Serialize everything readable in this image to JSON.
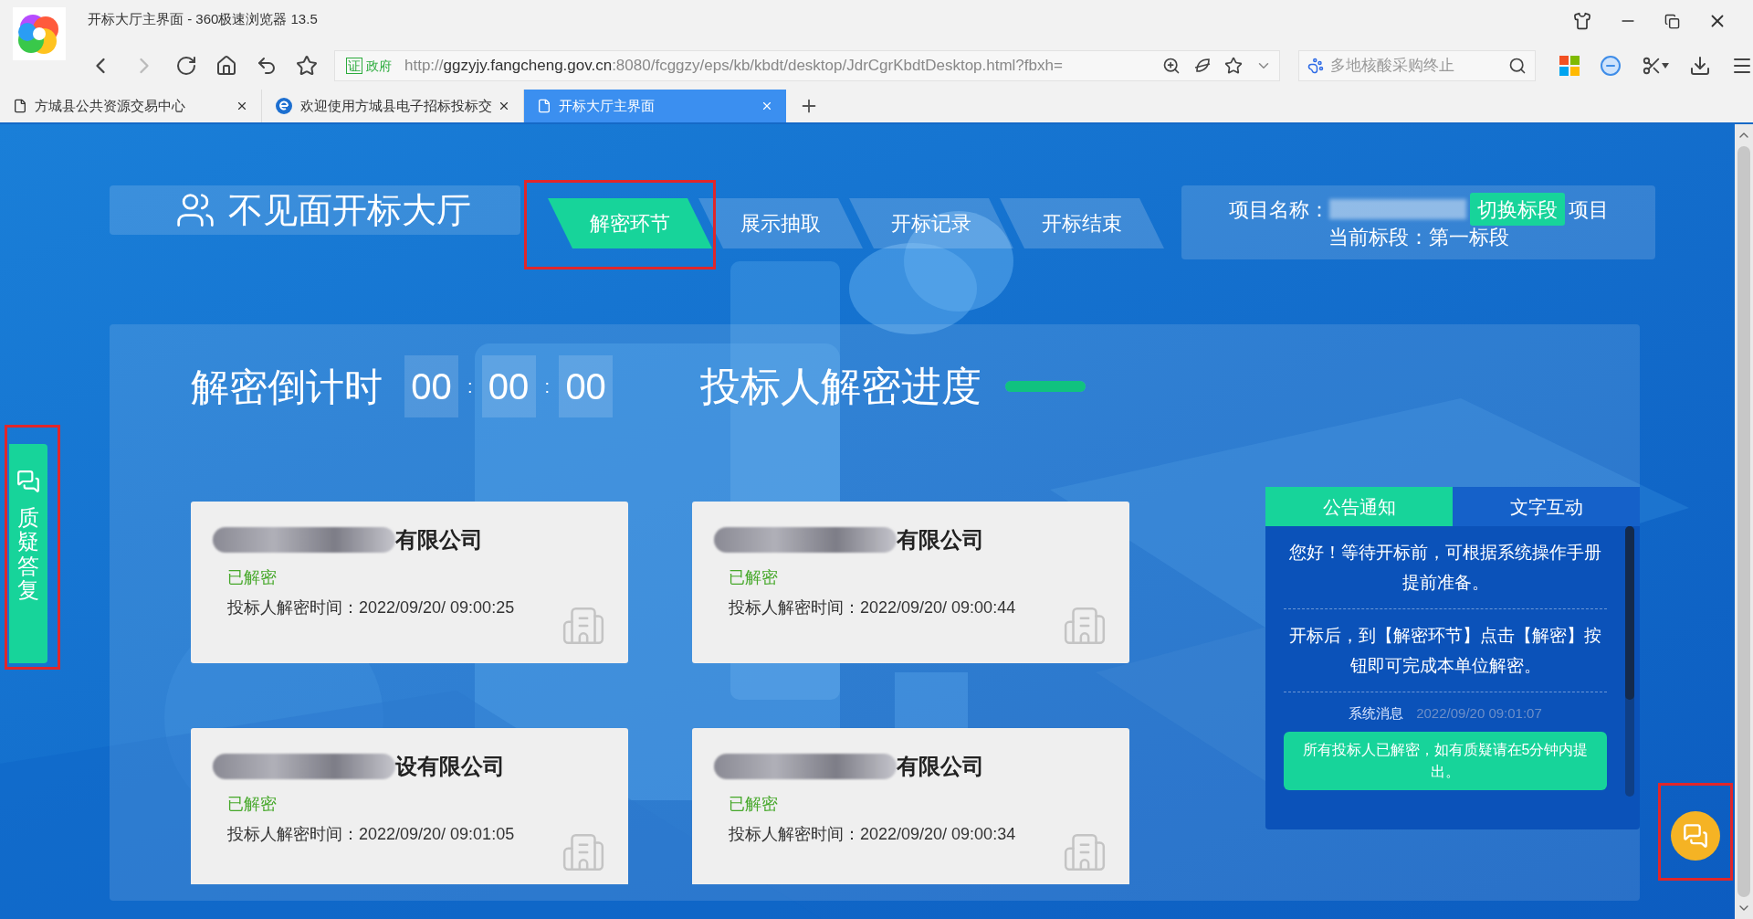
{
  "browser": {
    "window_title": "开标大厅主界面 - 360极速浏览器 13.5",
    "url_badge_icon": "证",
    "url_badge": "政府",
    "url_prefix": "http://",
    "url_host": "ggzyjy.fangcheng.gov.cn",
    "url_path": ":8080/fcggzy/eps/kb/kbdt/desktop/JdrCgrKbdtDesktop.html?fbxh=",
    "search": {
      "placeholder": "多地核酸采购终止"
    },
    "tabs": [
      {
        "title": "方城县公共资源交易中心",
        "selected": false,
        "kind": "page"
      },
      {
        "title": "欢迎使用方城县电子招标投标交",
        "selected": false,
        "kind": "site"
      },
      {
        "title": "开标大厅主界面",
        "selected": true,
        "kind": "page"
      }
    ]
  },
  "hall": {
    "title": "不见面开标大厅",
    "nav": [
      {
        "label": "解密环节",
        "selected": true
      },
      {
        "label": "展示抽取",
        "selected": false
      },
      {
        "label": "开标记录",
        "selected": false
      },
      {
        "label": "开标结束",
        "selected": false
      }
    ],
    "project": {
      "label": "项目名称：",
      "tail": "项目",
      "switch_button": "切换标段",
      "section": "当前标段：第一标段"
    }
  },
  "countdown": {
    "label": "解密倒计时",
    "parts": [
      {
        "kind": "digits",
        "text": "00"
      },
      {
        "kind": "separator",
        "text": ":"
      },
      {
        "kind": "digits",
        "text": "00"
      },
      {
        "kind": "separator",
        "text": ":"
      },
      {
        "kind": "digits",
        "text": "00"
      }
    ]
  },
  "progress": {
    "label": "投标人解密进度",
    "level": 1
  },
  "bidders": [
    {
      "name": "有限公司",
      "status": "已解密",
      "info": "投标人解密时间：2022/09/20/ 09:00:25"
    },
    {
      "name": "有限公司",
      "status": "已解密",
      "info": "投标人解密时间：2022/09/20/ 09:00:44"
    },
    {
      "name": "设有限公司",
      "status": "已解密",
      "info": "投标人解密时间：2022/09/20/ 09:01:05"
    },
    {
      "name": "有限公司",
      "status": "已解密",
      "info": "投标人解密时间：2022/09/20/ 09:00:34"
    }
  ],
  "notice_panel": {
    "tabs": [
      {
        "label": "公告通知",
        "selected": true
      },
      {
        "label": "文字互动",
        "selected": false
      }
    ],
    "messages": [
      {
        "kind": "notice",
        "text": "您好！等待开标前，可根据系统操作手册提前准备。"
      },
      {
        "kind": "notice",
        "text": "开标后，到【解密环节】点击【解密】按钮即可完成本单位解密。"
      },
      {
        "kind": "system",
        "sender": "系统消息",
        "time": "2022/09/20 09:01:07",
        "text": "所有投标人已解密，如有质疑请在5分钟内提出。"
      }
    ]
  },
  "side_tab": {
    "label": "质疑答复"
  }
}
